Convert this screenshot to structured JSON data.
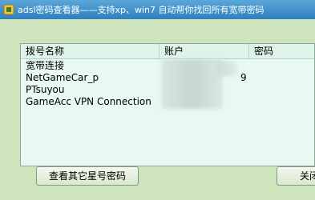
{
  "window": {
    "title": "adsl密码查看器——支持xp、win7 自动帮你找回所有宽带密码"
  },
  "list": {
    "columns": [
      "拨号名称",
      "账户",
      "密码"
    ],
    "rows": [
      {
        "name": "宽带连接"
      },
      {
        "name": "NetGameCar_p",
        "account_suffix": "9"
      },
      {
        "name": "PTsuyou"
      },
      {
        "name": "GameAcc VPN Connection"
      }
    ]
  },
  "buttons": {
    "view_other": "查看其它星号密码",
    "close": "关闭"
  },
  "colors": {
    "titlebar": "#3f8fcb",
    "client_bg": "#cde4bc",
    "list_bg": "#e8f8f2"
  },
  "icons": {
    "title_icon": "app-icon"
  }
}
